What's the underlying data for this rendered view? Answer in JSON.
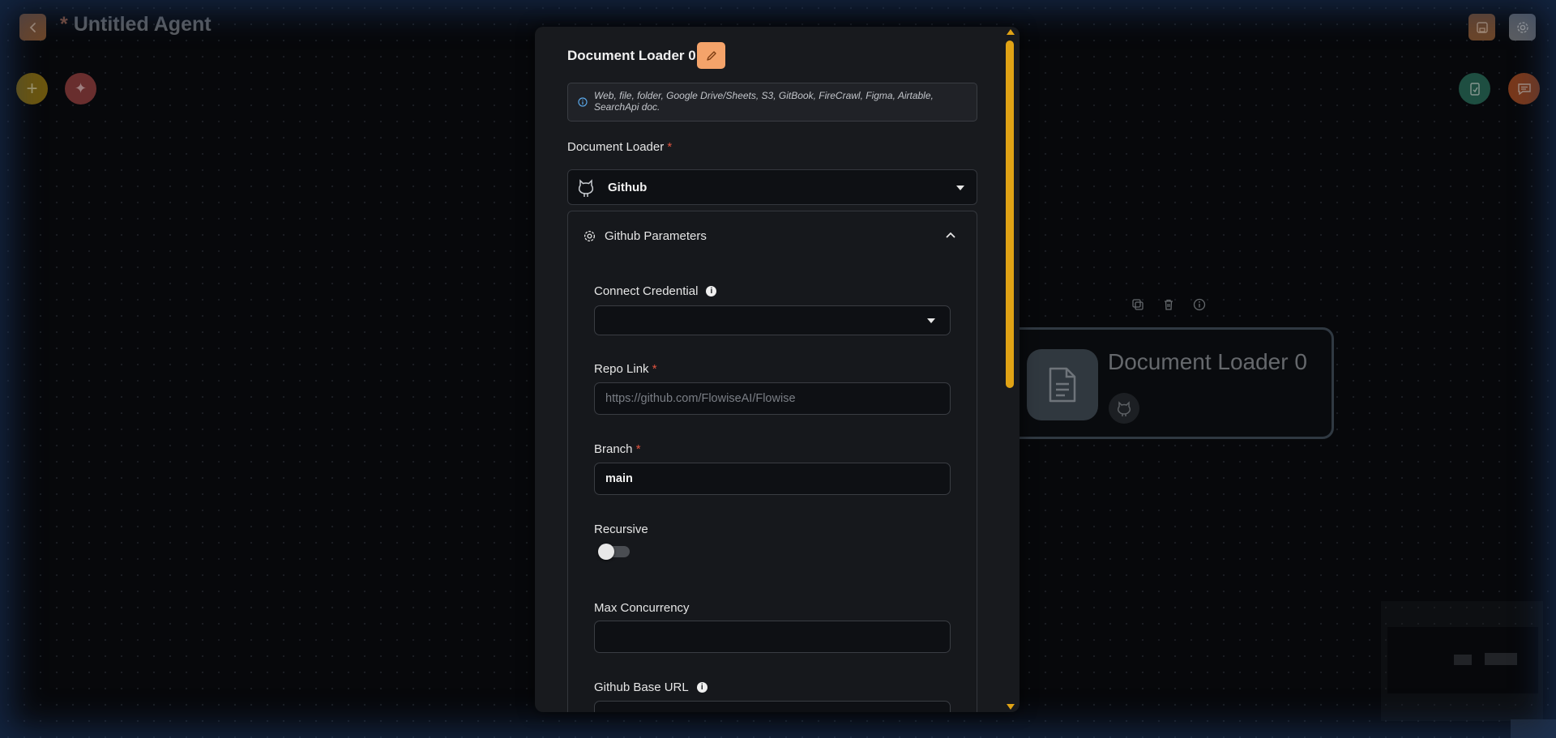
{
  "app": {
    "title": "Untitled Agent",
    "unsaved_marker": "*"
  },
  "canvas": {
    "node": {
      "title": "Document Loader 0",
      "icon": "document-icon",
      "sub_icon": "github-icon"
    },
    "node_toolbar": [
      "copy-icon",
      "trash-icon",
      "info-icon"
    ]
  },
  "panel": {
    "title": "Document Loader 0",
    "description": "Web, file, folder, Google Drive/Sheets, S3, GitBook, FireCrawl, Figma, Airtable, SearchApi doc.",
    "document_loader_label": "Document Loader",
    "required_marker": "*",
    "document_loader_value": "Github",
    "params_section_title": "Github Parameters",
    "fields": {
      "connect_credential": {
        "label": "Connect Credential",
        "value": ""
      },
      "repo_link": {
        "label": "Repo Link",
        "placeholder": "https://github.com/FlowiseAI/Flowise",
        "value": ""
      },
      "branch": {
        "label": "Branch",
        "value": "main"
      },
      "recursive": {
        "label": "Recursive",
        "checked": false
      },
      "max_concurrency": {
        "label": "Max Concurrency",
        "value": ""
      },
      "github_base_url": {
        "label": "Github Base URL"
      }
    }
  },
  "colors": {
    "accent_orange": "#f4a36a",
    "scroll_yellow": "#e0a315",
    "required_red": "#e0533f"
  }
}
